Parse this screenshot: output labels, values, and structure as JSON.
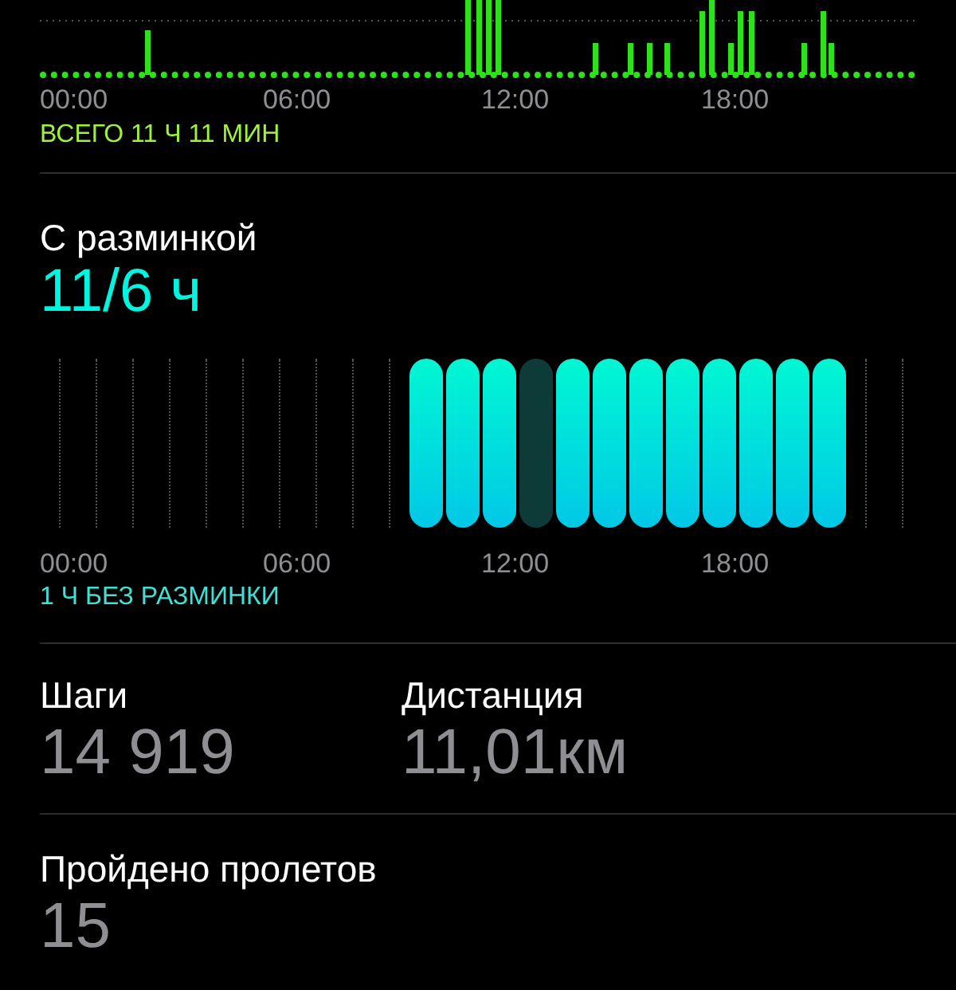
{
  "steps_chart": {
    "time_labels": [
      "00:00",
      "06:00",
      "12:00",
      "18:00"
    ],
    "total": "ВСЕГО 11 Ч 11 МИН"
  },
  "stand": {
    "title": "С разминкой",
    "value": "11/6 ч",
    "hours": [
      {
        "kind": "none"
      },
      {
        "kind": "none"
      },
      {
        "kind": "none"
      },
      {
        "kind": "none"
      },
      {
        "kind": "none"
      },
      {
        "kind": "none"
      },
      {
        "kind": "none"
      },
      {
        "kind": "none"
      },
      {
        "kind": "none"
      },
      {
        "kind": "none"
      },
      {
        "kind": "stood"
      },
      {
        "kind": "stood"
      },
      {
        "kind": "stood"
      },
      {
        "kind": "missed"
      },
      {
        "kind": "stood"
      },
      {
        "kind": "stood"
      },
      {
        "kind": "stood"
      },
      {
        "kind": "stood"
      },
      {
        "kind": "stood"
      },
      {
        "kind": "stood"
      },
      {
        "kind": "stood"
      },
      {
        "kind": "stood"
      },
      {
        "kind": "none"
      },
      {
        "kind": "none"
      }
    ],
    "time_labels": [
      "00:00",
      "06:00",
      "12:00",
      "18:00"
    ],
    "summary": "1 Ч БЕЗ РАЗМИНКИ"
  },
  "steps": {
    "label": "Шаги",
    "value": "14 919"
  },
  "distance": {
    "label": "Дистанция",
    "value": "11,01км"
  },
  "flights": {
    "label": "Пройдено пролетов",
    "value": "15"
  }
}
